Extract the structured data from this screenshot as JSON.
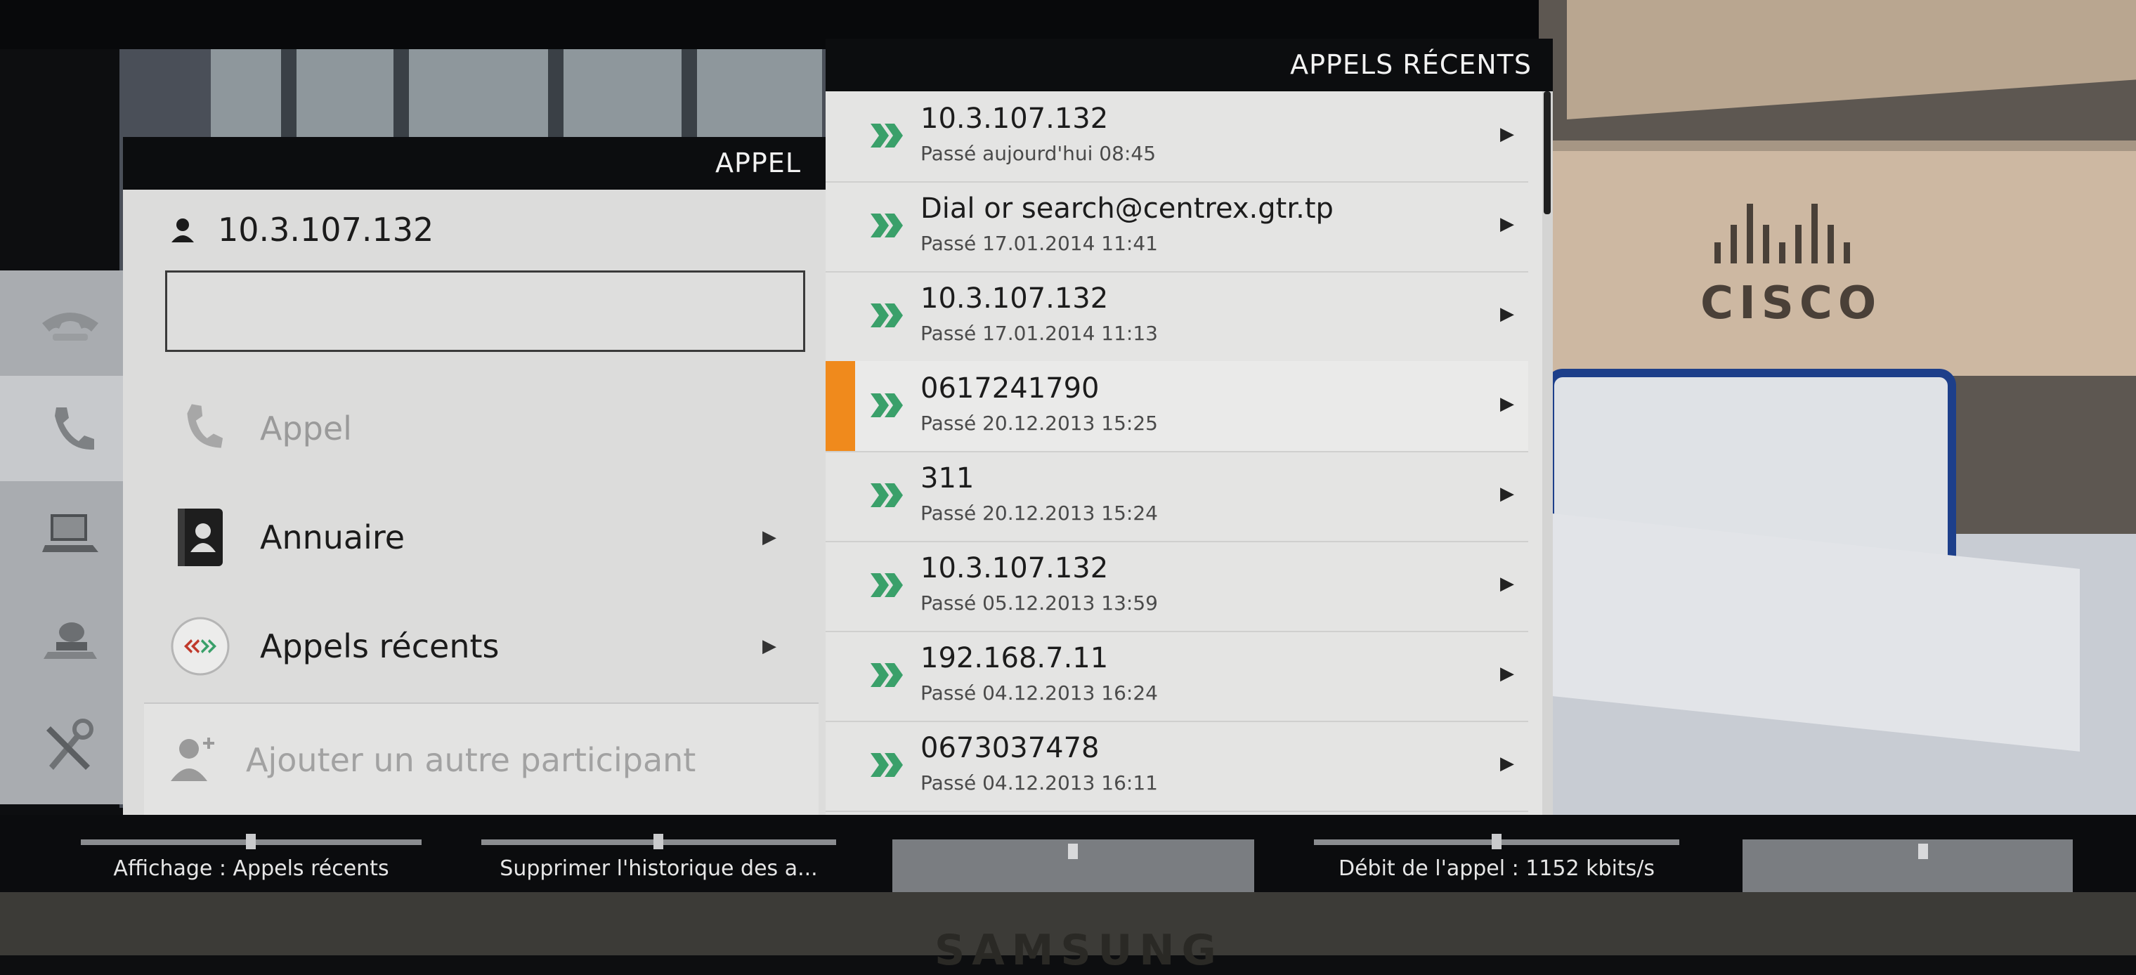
{
  "background": {
    "brand_logo": "CISCO",
    "monitor_brand": "SAMSUNG"
  },
  "rail": {
    "items": [
      {
        "name": "handset-icon"
      },
      {
        "name": "call-icon"
      },
      {
        "name": "laptop-icon"
      },
      {
        "name": "camera-icon"
      },
      {
        "name": "settings-tools-icon"
      }
    ]
  },
  "appel": {
    "title": "APPEL",
    "destination": "10.3.107.132",
    "search_value": "",
    "menu": {
      "call": "Appel",
      "directory": "Annuaire",
      "recent": "Appels récents",
      "add_participant": "Ajouter un autre participant"
    }
  },
  "recent": {
    "title": "APPELS RÉCENTS",
    "items": [
      {
        "number": "10.3.107.132",
        "detail": "Passé aujourd'hui 08:45"
      },
      {
        "number": "Dial or search@centrex.gtr.tp",
        "detail": "Passé 17.01.2014 11:41"
      },
      {
        "number": "10.3.107.132",
        "detail": "Passé 17.01.2014 11:13"
      },
      {
        "number": "0617241790",
        "detail": "Passé 20.12.2013 15:25"
      },
      {
        "number": "311",
        "detail": "Passé 20.12.2013 15:24"
      },
      {
        "number": "10.3.107.132",
        "detail": "Passé 05.12.2013 13:59"
      },
      {
        "number": "192.168.7.11",
        "detail": "Passé 04.12.2013 16:24"
      },
      {
        "number": "0673037478",
        "detail": "Passé 04.12.2013 16:11"
      }
    ],
    "selected_index": 3,
    "accent_color": "#f08a1c",
    "chevron_color": "#3aa06a"
  },
  "softkeys": {
    "key1": "Affichage : Appels récents",
    "key2": "Supprimer l'historique des a...",
    "key3": "",
    "key4": "Débit de l'appel : 1152 kbits/s",
    "key5": ""
  }
}
